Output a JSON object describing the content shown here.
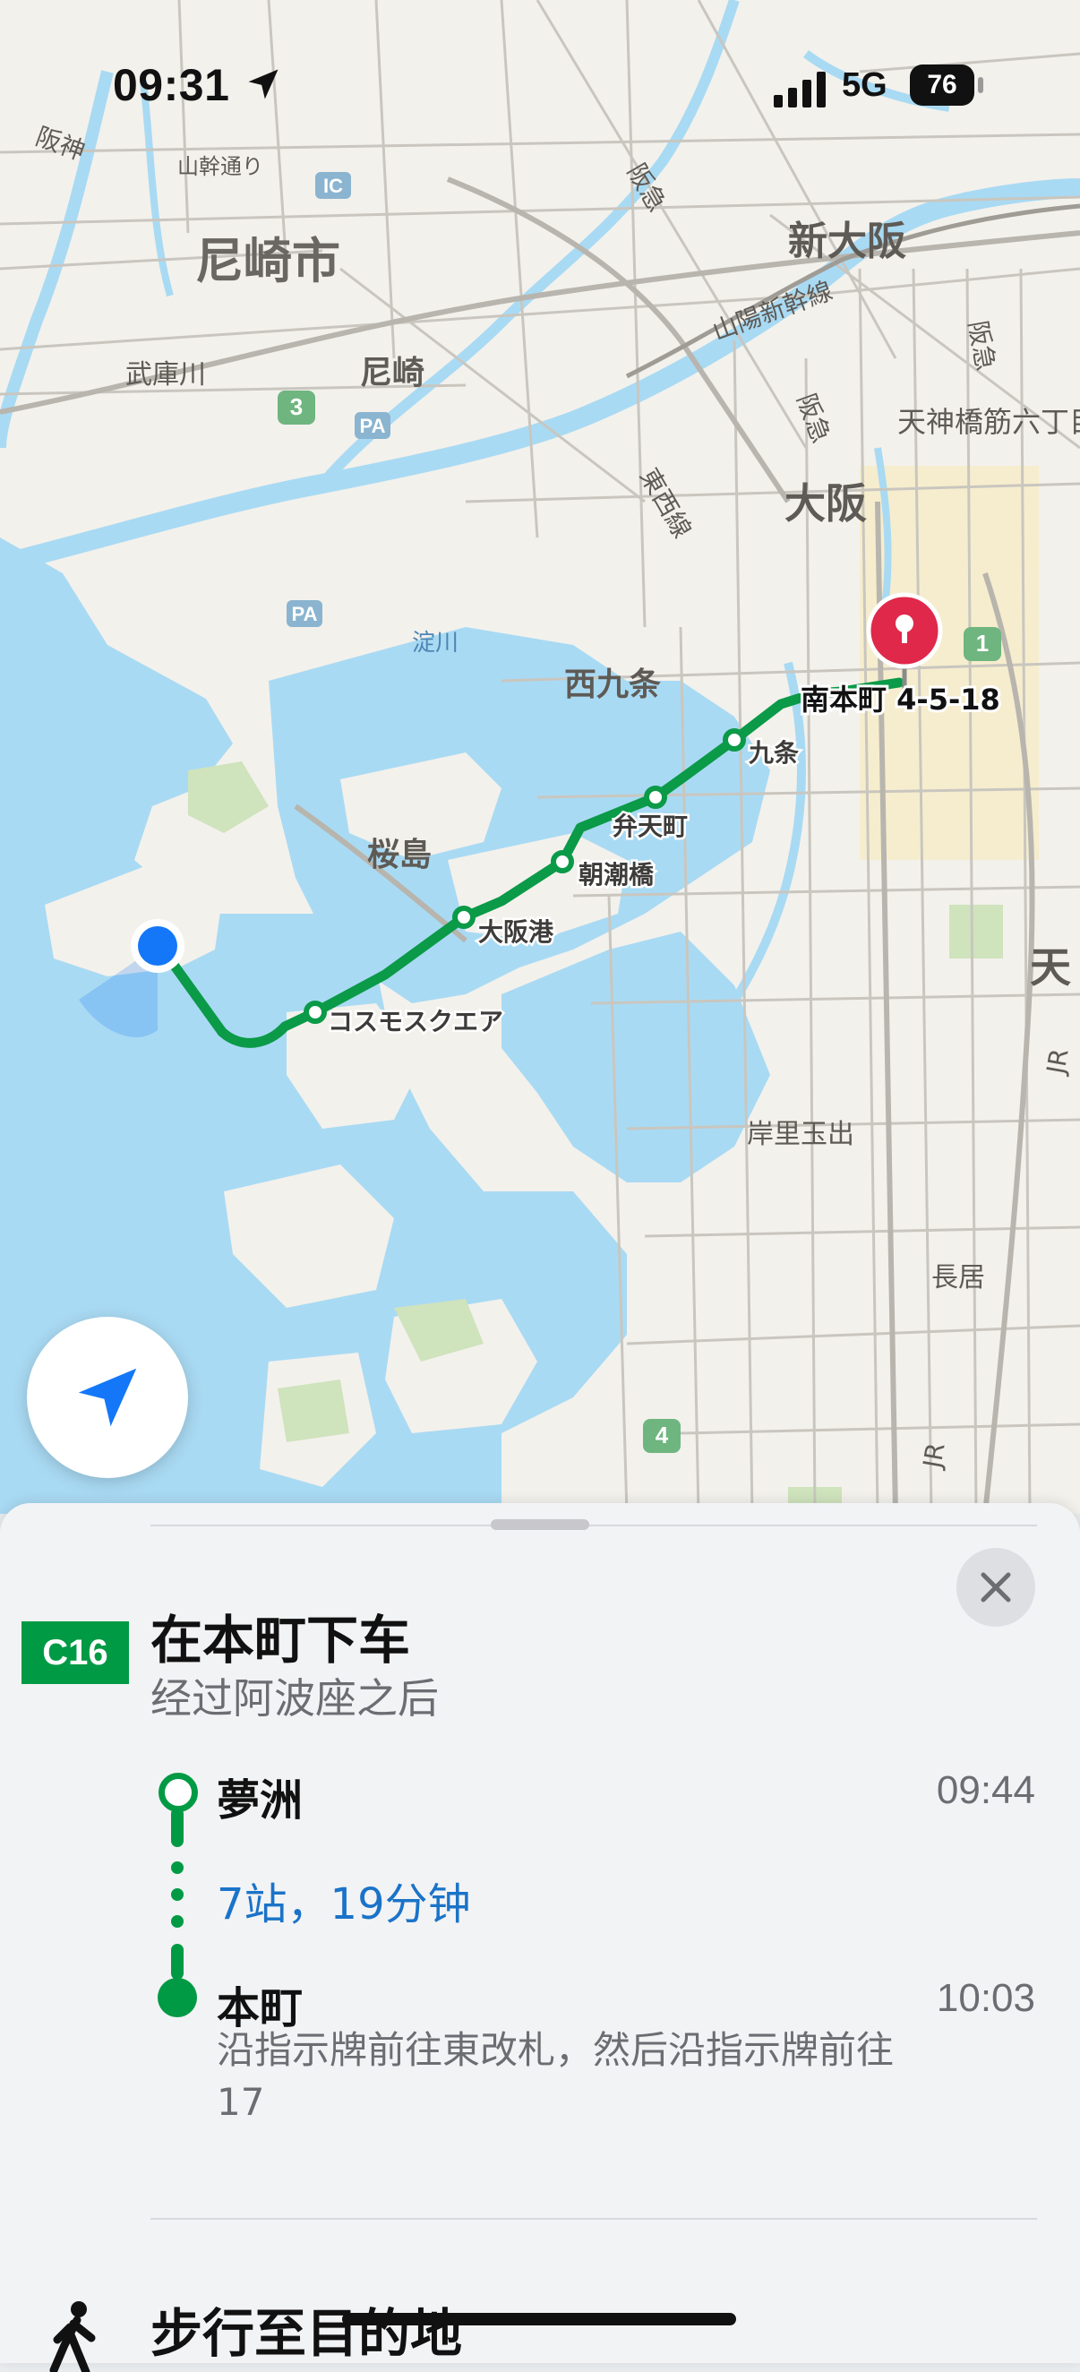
{
  "status_bar": {
    "time": "09:31",
    "network": "5G",
    "battery": "76"
  },
  "map": {
    "labels": {
      "amagasaki_city": "尼崎市",
      "amagasaki": "尼崎",
      "mukogawa": "武庫川",
      "sanmi_dori": "山幹通り",
      "shin_osaka": "新大阪",
      "sanyo_shinkansen": "山陽新幹線",
      "hankyu_top": "阪急",
      "hankyu_mid": "阪急",
      "hankyu_right": "阪急",
      "hanshin_left": "阪神",
      "tenjinbashi": "天神橋筋六丁目",
      "osaka": "大阪",
      "tozai_line": "東西線",
      "yodogawa": "淀川",
      "nishikujo": "西九条",
      "sakurajima": "桜島",
      "kishiritamade": "岸里玉出",
      "nagai": "長居",
      "ten_partial": "天",
      "jr_right": "JR",
      "jr_bottom": "JR",
      "ic": "IC",
      "pa1": "PA",
      "pa2": "PA",
      "route3": "3",
      "route1": "1",
      "route4": "4"
    },
    "stations": {
      "cosmosquare": "コスモスクエア",
      "osakako": "大阪港",
      "asashiobashi": "朝潮橋",
      "bentencho": "弁天町",
      "kujo": "九条"
    },
    "destination": "南本町 4-5-18",
    "colors": {
      "route": "#0a9a48",
      "water": "#a9daf3",
      "land": "#f3f1ec",
      "pin": "#e0284a",
      "user": "#1477f8"
    }
  },
  "sheet": {
    "line_badge": "C16",
    "title": "在本町下车",
    "subtitle": "经过阿波座之后",
    "start_stop": {
      "name": "夢洲",
      "time": "09:44"
    },
    "summary": "7站，19分钟",
    "end_stop": {
      "name": "本町",
      "time": "10:03"
    },
    "instruction": "沿指示牌前往東改札，然后沿指示牌前往17",
    "next_step": "步行至目的地"
  }
}
